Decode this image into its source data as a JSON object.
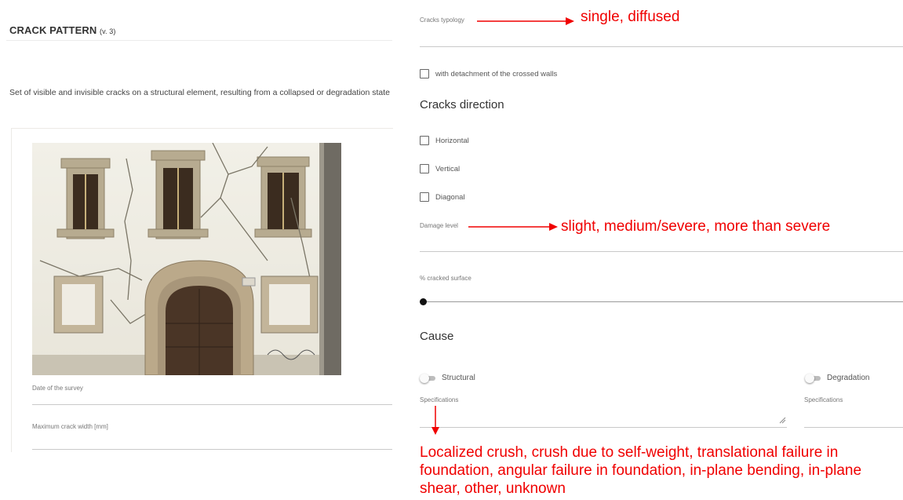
{
  "left": {
    "title": "CRACK PATTERN",
    "title_version": "(v. 3)",
    "description": "Set of visible and invisible cracks on a structural element, resulting from a collapsed or degradation state",
    "photo_alt": "photo of cracked historic building facade",
    "date_label": "Date of the survey",
    "max_width_label": "Maximum crack width [mm]"
  },
  "right": {
    "typology_label": "Cracks typology",
    "typology_note": "single, diffused",
    "detachment_label": "with detachment of the crossed walls",
    "direction_heading": "Cracks direction",
    "directions": [
      "Horizontal",
      "Vertical",
      "Diagonal"
    ],
    "damage_label": "Damage level",
    "damage_note": "slight, medium/severe, more than severe",
    "cracked_surface_label": "% cracked surface",
    "cracked_surface_value": 0,
    "cause_heading": "Cause",
    "structural_label": "Structural",
    "degradation_label": "Degradation",
    "specifications_label": "Specifications",
    "cause_note": "Localized crush, crush due to self-weight, translational failure in foundation, angular failure in foundation, in-plane bending, in-plane shear, other, unknown"
  },
  "colors": {
    "annotation": "#f00000",
    "underline": "#c9c9c9",
    "text": "#333333"
  }
}
